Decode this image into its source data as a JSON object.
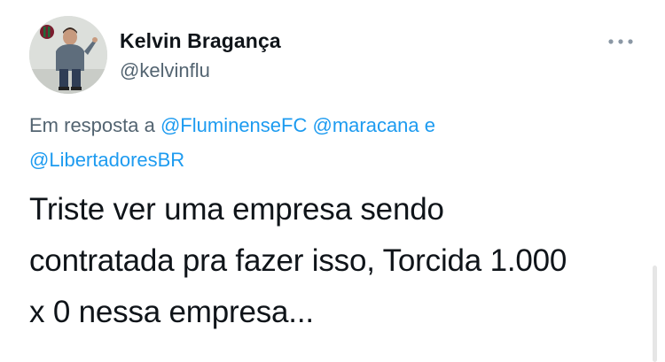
{
  "author": {
    "display_name": "Kelvin Bragança",
    "handle": "@kelvinflu"
  },
  "more_icon": "more-horizontal-icon",
  "reply": {
    "prefix": "Em resposta a",
    "mentions": [
      "@FluminenseFC",
      "@maracana",
      "@LibertadoresBR"
    ],
    "conjunction": "e"
  },
  "tweet": {
    "line1": "Triste ver uma empresa sendo",
    "line2": "contratada pra fazer isso, Torcida 1.000",
    "line3": "x 0 nessa empresa..."
  },
  "colors": {
    "link": "#1d9bf0",
    "secondary": "#536471",
    "text": "#0f1419"
  }
}
